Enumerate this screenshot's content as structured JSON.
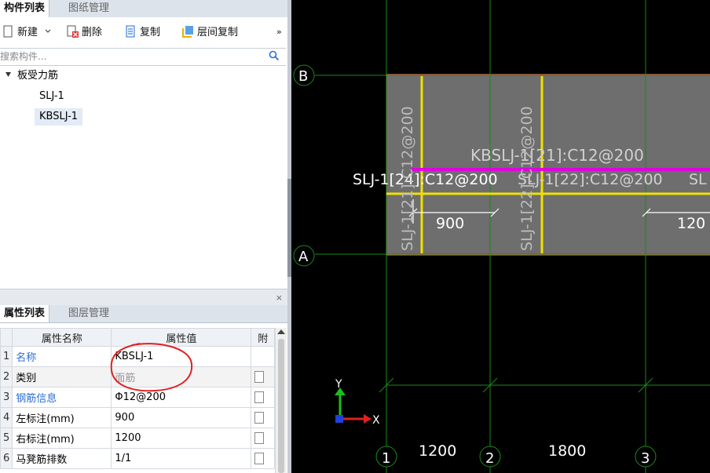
{
  "component_panel": {
    "tabs": [
      {
        "label": "构件列表"
      },
      {
        "label": "图纸管理"
      }
    ],
    "toolbar": {
      "new_label": "新建",
      "delete_label": "删除",
      "copy_label": "复制",
      "floor_copy_label": "层间复制",
      "more_glyph": "»"
    },
    "search_placeholder": "搜索构件...",
    "tree": {
      "root_label": "板受力筋",
      "items": [
        {
          "label": "SLJ-1"
        },
        {
          "label": "KBSLJ-1"
        }
      ]
    }
  },
  "property_panel": {
    "close_glyph": "×",
    "tabs": [
      {
        "label": "属性列表"
      },
      {
        "label": "图层管理"
      }
    ],
    "columns": [
      "属性名称",
      "属性值",
      "附"
    ],
    "rows": [
      {
        "num": "1",
        "name": "名称",
        "value": "KBSLJ-1"
      },
      {
        "num": "2",
        "name": "类别",
        "value": "面筋"
      },
      {
        "num": "3",
        "name": "钢筋信息",
        "value": "Φ12@200"
      },
      {
        "num": "4",
        "name": "左标注(mm)",
        "value": "900"
      },
      {
        "num": "5",
        "name": "右标注(mm)",
        "value": "1200"
      },
      {
        "num": "6",
        "name": "马凳筋排数",
        "value": "1/1"
      }
    ]
  },
  "drawing": {
    "axis_b": "B",
    "axis_a": "A",
    "axis_1": "1",
    "axis_2": "2",
    "axis_3": "3",
    "dim_1200": "1200",
    "dim_1800": "1800",
    "rebar_kbslj": "KBSLJ-1[21]:C12@200",
    "rebar_slj_left": "SLJ-1[24]:C12@200",
    "rebar_slj_mid": "SLJ-1[22]:C12@200",
    "rebar_slj_right": "SL",
    "vert_label_left": "SLJ-1[21]:C12@200",
    "vert_label_mid": "SLJ-1[22]:C12@200",
    "dim_900": "900",
    "dim_1200_right": "120",
    "ucs_y": "Y",
    "ucs_x": "X"
  },
  "colors": {
    "grid_line": "#1a8a1a",
    "slab_fill": "#6e6e6e",
    "slab_border": "#e06060",
    "rebar_yellow": "#f0e000",
    "rebar_magenta": "#e000e0",
    "annotation_red": "#e02020",
    "link_blue": "#2b6fd6"
  }
}
